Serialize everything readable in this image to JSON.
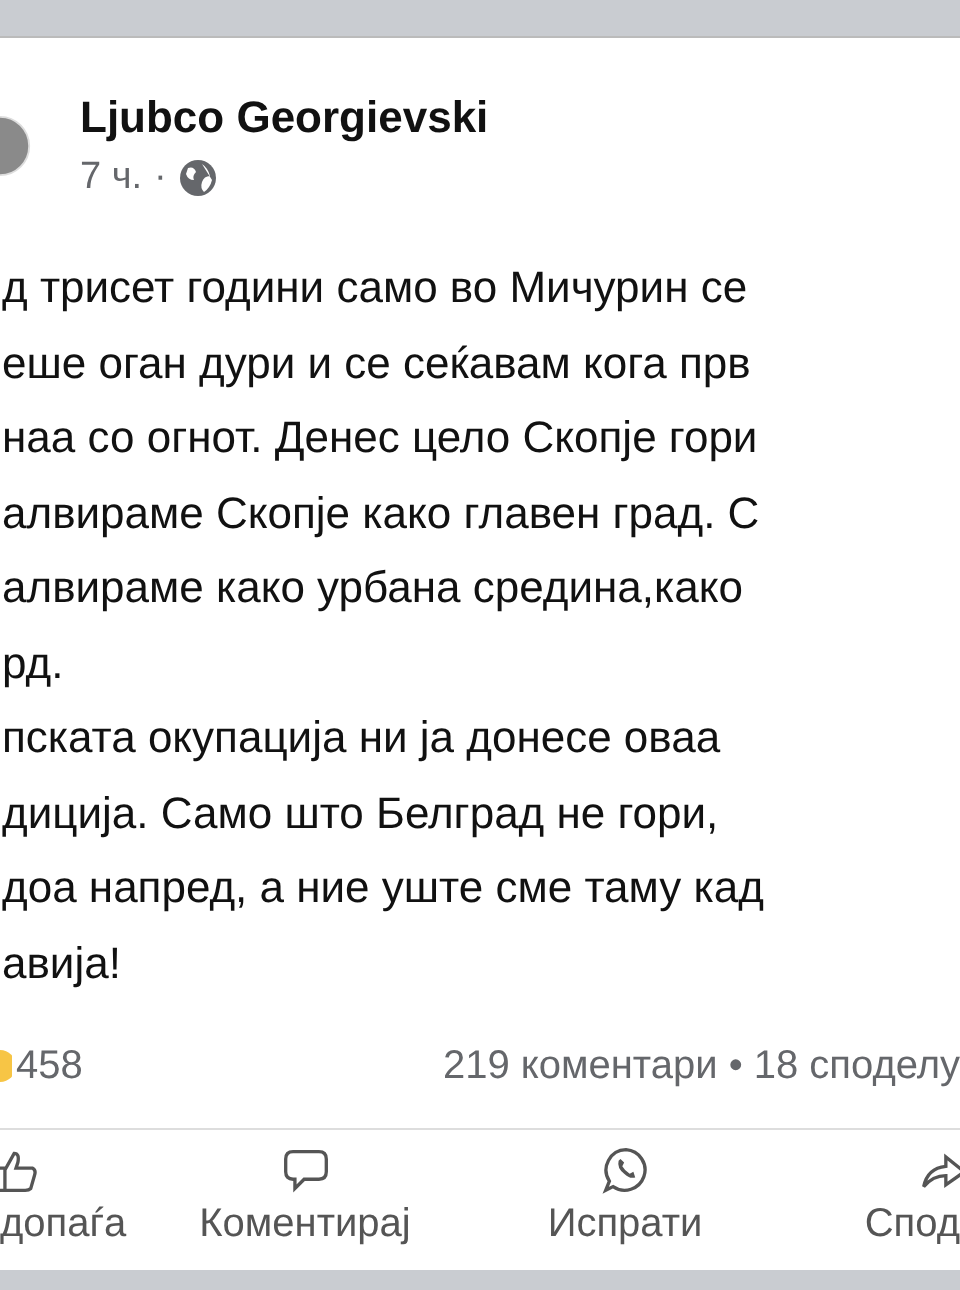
{
  "post": {
    "author": "Ljubco Georgievski",
    "time": "7 ч.",
    "separator": "·",
    "lines": [
      "д трисет години само во Мичурин се",
      "еше оган дури и се сеќавам кога прв",
      "наа со огнот. Денес цело Скопје гори",
      "алвираме Скопје како главен град. С",
      "алвираме како урбана средина,како",
      "рд.",
      "пската окупација ни ја донесе оваа",
      "диција. Само што Белград не гори,",
      "доа напред, а ние уште сме таму кад",
      "авија!"
    ]
  },
  "stats": {
    "reactions": "458",
    "comments_shares": "219 коментари • 18 споделу"
  },
  "actions": [
    {
      "kind": "like",
      "label": "допаѓа"
    },
    {
      "kind": "comment",
      "label": "Коментирај"
    },
    {
      "kind": "send",
      "label": "Испрати"
    },
    {
      "kind": "share",
      "label": "Спод"
    }
  ]
}
